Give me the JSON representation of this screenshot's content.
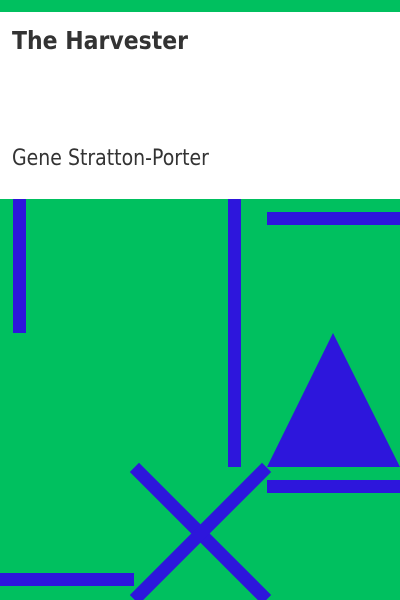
{
  "cover": {
    "title": "The Harvester",
    "author": "Gene Stratton-Porter",
    "colors": {
      "background": "#00c05f",
      "panel": "#ffffff",
      "text": "#333333",
      "shapes": "#2d16dc"
    },
    "artwork": {
      "shapes": [
        "vertical-bar",
        "vertical-bar",
        "horizontal-bar",
        "triangle",
        "horizontal-bar",
        "cross",
        "horizontal-bar"
      ]
    }
  }
}
